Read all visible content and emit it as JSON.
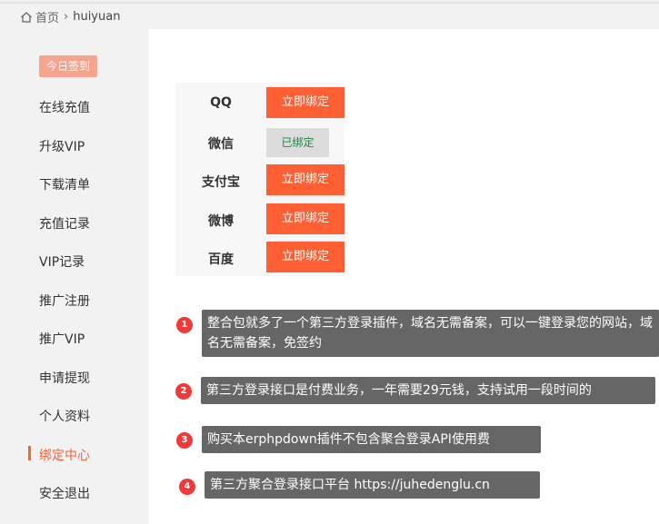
{
  "breadcrumb": {
    "home_icon": "home-icon",
    "home": "首页",
    "separator": "›",
    "current": "huiyuan"
  },
  "sidebar": {
    "checkin_label": "今日签到",
    "items": [
      {
        "label": "在线充值"
      },
      {
        "label": "升级VIP"
      },
      {
        "label": "下载清单"
      },
      {
        "label": "充值记录"
      },
      {
        "label": "VIP记录"
      },
      {
        "label": "推广注册"
      },
      {
        "label": "推广VIP"
      },
      {
        "label": "申请提现"
      },
      {
        "label": "个人资料"
      },
      {
        "label": "绑定中心",
        "active": true
      },
      {
        "label": "安全退出"
      }
    ]
  },
  "bindings": [
    {
      "name": "QQ",
      "action": "立即绑定",
      "bound": false
    },
    {
      "name": "微信",
      "action": "已绑定",
      "bound": true
    },
    {
      "name": "支付宝",
      "action": "立即绑定",
      "bound": false
    },
    {
      "name": "微博",
      "action": "立即绑定",
      "bound": false
    },
    {
      "name": "百度",
      "action": "立即绑定",
      "bound": false
    }
  ],
  "notes": [
    {
      "num": "1",
      "text": "整合包就多了一个第三方登录插件，域名无需备案，可以一键登录您的网站，域名无需备案，免签约"
    },
    {
      "num": "2",
      "text": "第三方登录接口是付费业务，一年需要29元钱，支持试用一段时间的"
    },
    {
      "num": "3",
      "text": "购买本erphpdown插件不包含聚合登录API使用费"
    },
    {
      "num": "4",
      "text": "第三方聚合登录接口平台  https://juhedenglu.cn"
    }
  ],
  "colors": {
    "accent": "#ff5f33",
    "checkin": "#f6a48e",
    "bound_text": "#1c8a3c",
    "note_bg": "#666666",
    "note_num": "#f03a3a"
  }
}
